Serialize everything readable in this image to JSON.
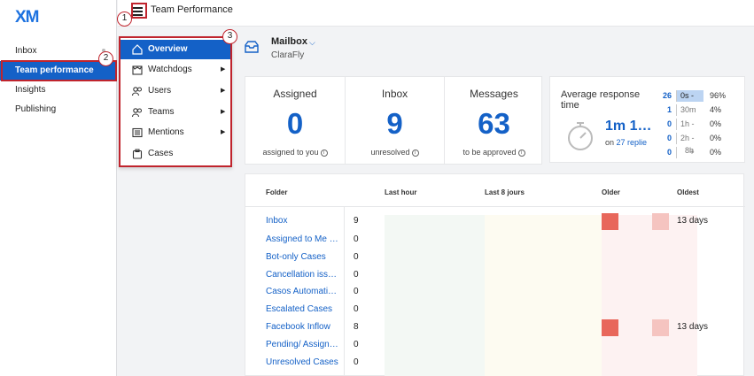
{
  "logo": "XM",
  "nav": {
    "items": [
      {
        "label": "Inbox"
      },
      {
        "label": "Team performance"
      },
      {
        "label": "Insights"
      },
      {
        "label": "Publishing"
      }
    ]
  },
  "header": {
    "title": "Team Performance"
  },
  "mailbox": {
    "name": "Mailbox",
    "sub": "ClaraFly"
  },
  "menu": {
    "items": [
      {
        "label": "Overview",
        "icon": "home-icon"
      },
      {
        "label": "Watchdogs",
        "icon": "watchdog-icon"
      },
      {
        "label": "Users",
        "icon": "users-icon"
      },
      {
        "label": "Teams",
        "icon": "teams-icon"
      },
      {
        "label": "Mentions",
        "icon": "mentions-icon"
      },
      {
        "label": "Cases",
        "icon": "cases-icon"
      }
    ]
  },
  "stats": [
    {
      "title": "Assigned",
      "value": "0",
      "note": "assigned to you"
    },
    {
      "title": "Inbox",
      "value": "9",
      "note": "unresolved"
    },
    {
      "title": "Messages",
      "value": "63",
      "note": "to be approved"
    }
  ],
  "response": {
    "title": "Average response time",
    "value": "1m 1…",
    "sub_prefix": "on",
    "sub_link": "27 replie",
    "distribution": [
      {
        "count": "26",
        "label": "0s -",
        "pct": "96%"
      },
      {
        "count": "1",
        "label": "30m",
        "pct": "4%"
      },
      {
        "count": "0",
        "label": "1h -",
        "pct": "0%"
      },
      {
        "count": "0",
        "label": "2h -",
        "pct": "0%"
      },
      {
        "count": "0",
        "label": "+",
        "pct": "0%"
      }
    ],
    "extra": "8h"
  },
  "table": {
    "headers": {
      "folder": "Folder",
      "last_hour": "Last hour",
      "last_8": "Last 8 jours",
      "older": "Older",
      "oldest": "Oldest"
    },
    "rows": [
      {
        "folder": "Inbox",
        "count": "9",
        "oldest": "13 days"
      },
      {
        "folder": "Assigned to Me …",
        "count": "0",
        "oldest": ""
      },
      {
        "folder": "Bot-only Cases",
        "count": "0",
        "oldest": ""
      },
      {
        "folder": "Cancellation iss…",
        "count": "0",
        "oldest": ""
      },
      {
        "folder": "Casos Automati…",
        "count": "0",
        "oldest": ""
      },
      {
        "folder": "Escalated Cases",
        "count": "0",
        "oldest": ""
      },
      {
        "folder": "Facebook Inflow",
        "count": "8",
        "oldest": "13 days"
      },
      {
        "folder": "Pending/ Assign…",
        "count": "0",
        "oldest": ""
      },
      {
        "folder": "Unresolved Cases",
        "count": "0",
        "oldest": ""
      }
    ]
  },
  "callouts": [
    "1",
    "2",
    "3"
  ],
  "colors": {
    "accent": "#1461c7",
    "callout": "#c0242d",
    "older": "#e8675b",
    "oldest": "#f5c4c0"
  }
}
